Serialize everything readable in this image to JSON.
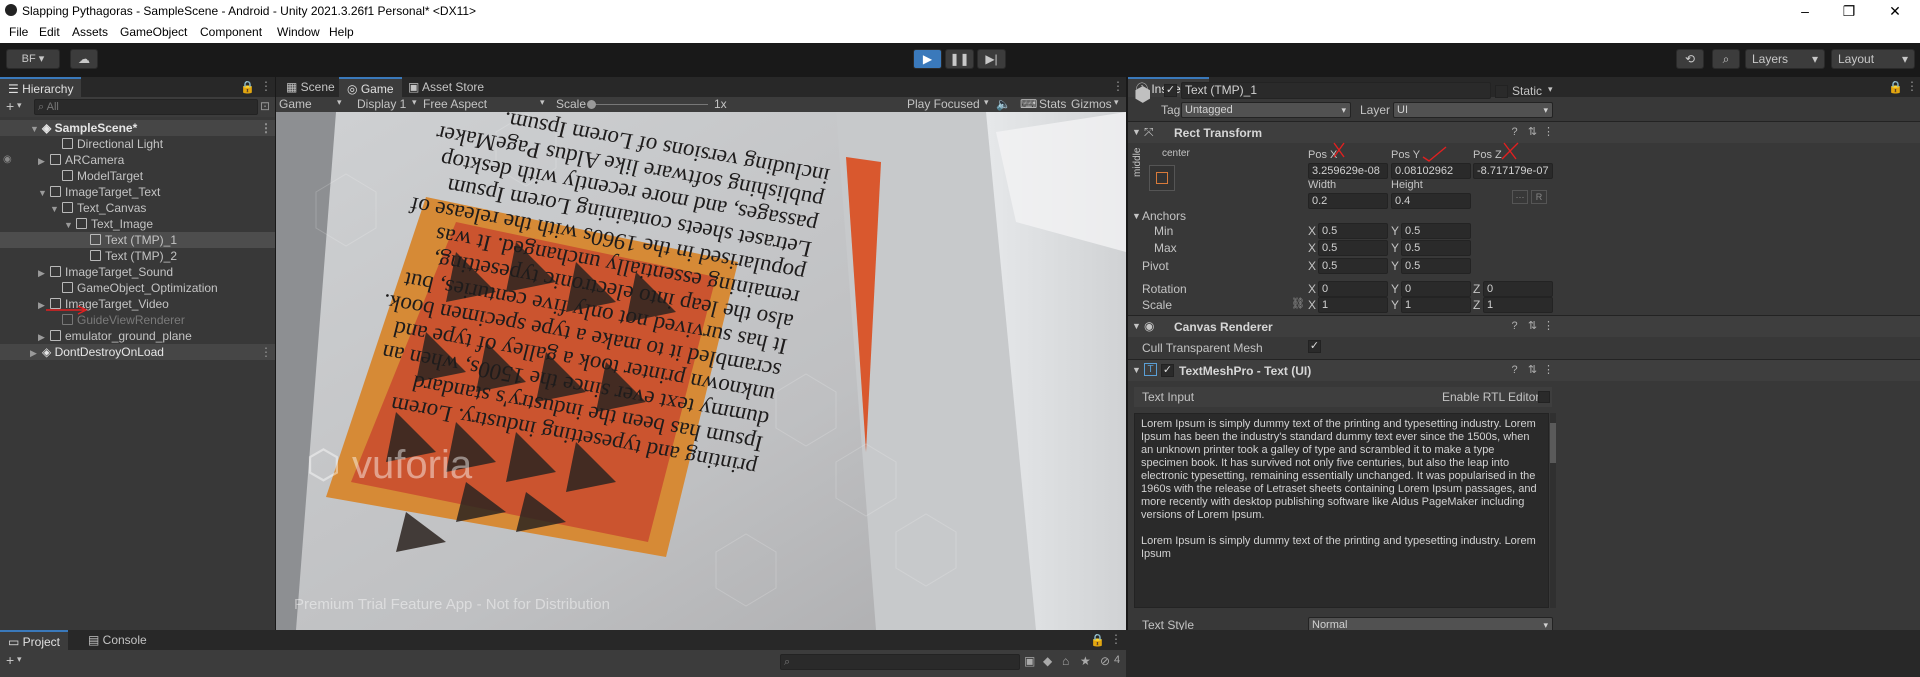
{
  "window": {
    "title": "Slapping Pythagoras - SampleScene - Android - Unity 2021.3.26f1 Personal* <DX11>",
    "minimize": "–",
    "maximize": "❐",
    "close": "✕"
  },
  "menu": [
    "File",
    "Edit",
    "Assets",
    "GameObject",
    "Component",
    "Window",
    "Help"
  ],
  "toolbar": {
    "account": "BF ▾",
    "layers": "Layers",
    "layout": "Layout"
  },
  "hierarchy": {
    "tab": "Hierarchy",
    "search_placeholder": "All",
    "items": [
      {
        "label": "SampleScene*"
      },
      {
        "label": "Directional Light"
      },
      {
        "label": "ARCamera"
      },
      {
        "label": "ModelTarget"
      },
      {
        "label": "ImageTarget_Text"
      },
      {
        "label": "Text_Canvas"
      },
      {
        "label": "Text_Image"
      },
      {
        "label": "Text (TMP)_1"
      },
      {
        "label": "Text (TMP)_2"
      },
      {
        "label": "ImageTarget_Sound"
      },
      {
        "label": "GameObject_Optimization"
      },
      {
        "label": "ImageTarget_Video"
      },
      {
        "label": "GuideViewRenderer"
      },
      {
        "label": "emulator_ground_plane"
      },
      {
        "label": "DontDestroyOnLoad"
      }
    ]
  },
  "center": {
    "tabs": [
      "Scene",
      "Game",
      "Asset Store"
    ],
    "game_dropdown": "Game",
    "display": "Display 1",
    "aspect": "Free Aspect",
    "scale_label": "Scale",
    "scale_value": "1x",
    "play_mode": "Play Focused",
    "stats": "Stats",
    "gizmos": "Gizmos"
  },
  "game_content": {
    "lines": [
      "printing and typesetting industry. Lorem",
      "Ipsum has been the industry's standard",
      "dummy text ever since the 1500s, when an",
      "unknown printer took a galley of type and",
      "scrambled it to make a type specimen book.",
      "It has survived not only five centuries, but",
      "also the leap into electronic typesetting,",
      "remaining essentially unchanged. It was",
      "popularised in the 1960s with the release of",
      "Letraset sheets containing Lorem Ipsum",
      "passages, and more recently with desktop",
      "publishing software like Aldus PageMaker",
      "including versions of Lorem Ipsum."
    ],
    "watermark_logo": "vuforia",
    "watermark_text": "Premium Trial Feature App - Not for Distribution"
  },
  "inspector": {
    "tab": "Inspector",
    "object_name": "Text (TMP)_1",
    "static_label": "Static",
    "tag_label": "Tag",
    "tag_value": "Untagged",
    "layer_label": "Layer",
    "layer_value": "UI",
    "rect_transform": {
      "title": "Rect Transform",
      "anchor_preset_h": "center",
      "anchor_preset_v": "middle",
      "posx_label": "Pos X",
      "posy_label": "Pos Y",
      "posz_label": "Pos Z",
      "posx": "3.259629e-08",
      "posy": "0.08102962",
      "posz": "-8.717179e-07",
      "width_label": "Width",
      "height_label": "Height",
      "width": "0.2",
      "height": "0.4",
      "anchors_label": "Anchors",
      "min_label": "Min",
      "max_label": "Max",
      "min_x": "0.5",
      "min_y": "0.5",
      "max_x": "0.5",
      "max_y": "0.5",
      "pivot_label": "Pivot",
      "pivot_x": "0.5",
      "pivot_y": "0.5",
      "rotation_label": "Rotation",
      "rot_x": "0",
      "rot_y": "0",
      "rot_z": "0",
      "scale_label": "Scale",
      "scale_x": "1",
      "scale_y": "1",
      "scale_z": "1",
      "x": "X",
      "y": "Y",
      "z": "Z",
      "r_button": "R"
    },
    "canvas_renderer": {
      "title": "Canvas Renderer",
      "cull_label": "Cull Transparent Mesh"
    },
    "tmp": {
      "title": "TextMeshPro - Text (UI)",
      "text_input": "Text Input",
      "rtl": "Enable RTL Editor",
      "paragraph1": "Lorem Ipsum is simply dummy text of the printing and typesetting industry. Lorem Ipsum has been the industry's standard dummy text ever since the 1500s, when an unknown printer took a galley of type and scrambled it to make a type specimen book. It has survived not only five centuries, but also the leap into electronic typesetting, remaining essentially unchanged. It was popularised in the 1960s with the release of Letraset sheets containing Lorem Ipsum passages, and more recently with desktop publishing software like Aldus PageMaker including versions of Lorem Ipsum.",
      "paragraph2": "Lorem Ipsum is simply dummy text of the printing and typesetting industry. Lorem Ipsum",
      "text_style_label": "Text Style",
      "text_style_value": "Normal"
    }
  },
  "bottom": {
    "tabs": [
      "Project",
      "Console"
    ],
    "badge": "4"
  }
}
